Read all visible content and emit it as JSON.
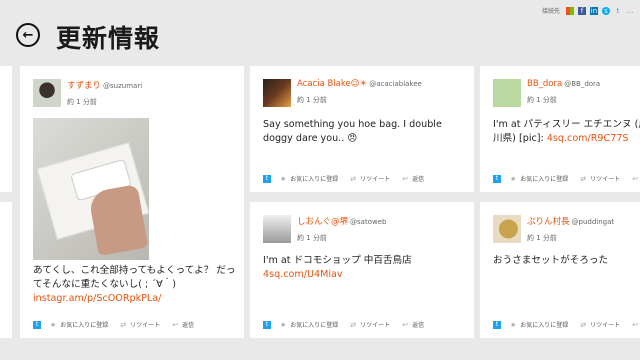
{
  "header": {
    "title": "更新情報"
  },
  "topbar": {
    "label": "接続先"
  },
  "cards": {
    "suzumari": {
      "name": "すずまり",
      "handle": "@suzumari",
      "time": "約 1 分前",
      "text": "あてくし、これ全部持ってもよくってよ？ だってそんなに重たくないし( ; ´∀｀)",
      "link": "instagr.am/p/ScOORpkPLa/"
    },
    "acacia": {
      "name": "Acacia Blake☺☀",
      "handle": "@acaciablakee",
      "time": "約 1 分前",
      "text": "Say something you hoe bag. I double doggy dare you.. 😠"
    },
    "bbdora": {
      "name": "BB_dora",
      "handle": "@BB_dora",
      "time": "約 1 分前",
      "text": "I'm at パティスリー エチエンヌ (川崎市, 神奈川県) [pic]:",
      "link": "4sq.com/R9C77S"
    },
    "satoweb": {
      "name": "しおんぐ@堺",
      "handle": "@satoweb",
      "time": "約 1 分前",
      "text": "I'm at ドコモショップ 中百舌鳥店",
      "link": "4sq.com/U4Miav"
    },
    "puddingat": {
      "name": "ぷりん村長",
      "handle": "@puddingat",
      "time": "約 1 分前",
      "text": "おうさまセットがそろった"
    }
  },
  "actions": {
    "favorite": "お気に入りに登録",
    "retweet": "リツイート",
    "reply": "返信"
  },
  "icons": {
    "back": "back-arrow-icon",
    "twitter": "twitter-icon",
    "favorite": "star-icon",
    "retweet": "retweet-icon",
    "reply": "reply-icon"
  },
  "colors": {
    "accent": "#e8530e",
    "twitter": "#1da1f2",
    "background": "#e9e9e9"
  }
}
